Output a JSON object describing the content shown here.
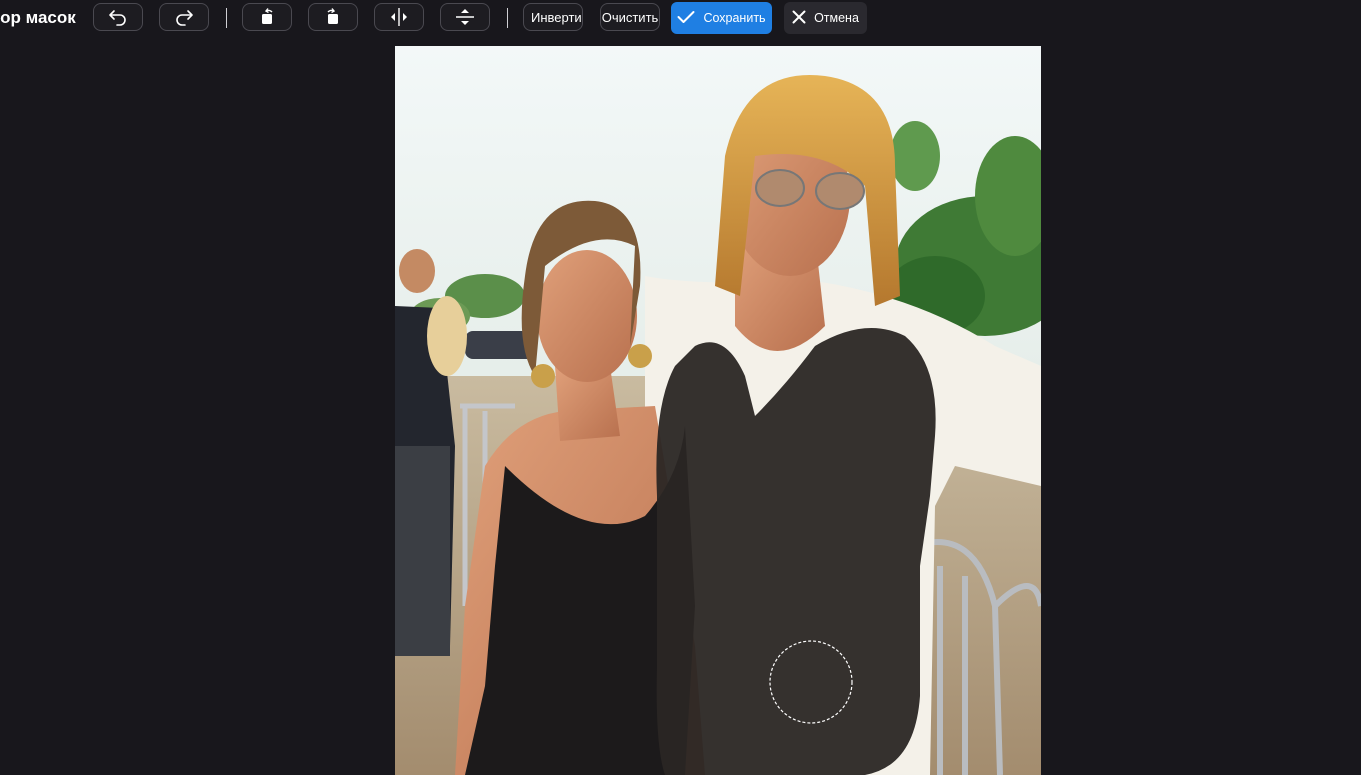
{
  "toolbar": {
    "title": "тор масок",
    "invert_label": "Инвертиро",
    "clear_label": "Очистить",
    "save_label": "Сохранить",
    "cancel_label": "Отмена"
  },
  "icons": {
    "undo": "undo-icon",
    "redo": "redo-icon",
    "rotate_left": "rotate-left-icon",
    "rotate_right": "rotate-right-icon",
    "flip_horizontal": "flip-horizontal-icon",
    "flip_vertical": "flip-vertical-icon",
    "save": "check-icon",
    "cancel": "close-icon"
  },
  "colors": {
    "background": "#18171c",
    "accent": "#1f7fe3",
    "mask": "#2a2624"
  }
}
